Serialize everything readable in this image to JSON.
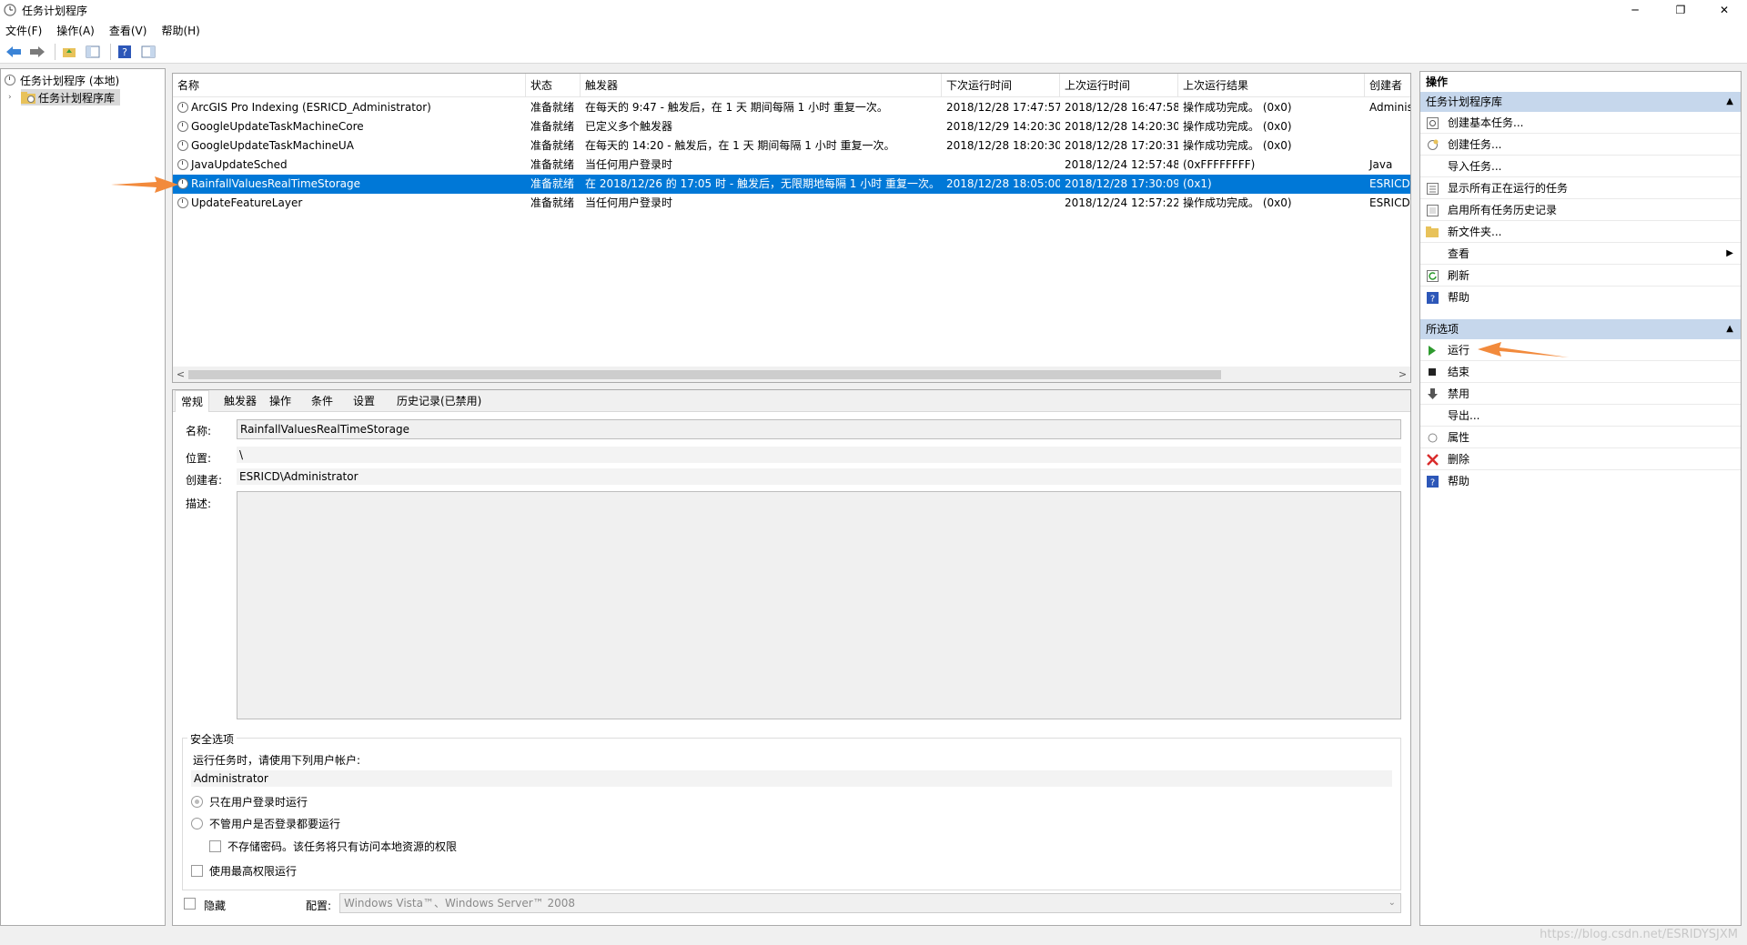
{
  "window": {
    "title": "任务计划程序",
    "controls": {
      "minimize": "─",
      "restore": "❐",
      "close": "✕"
    }
  },
  "menu": [
    "文件(F)",
    "操作(A)",
    "查看(V)",
    "帮助(H)"
  ],
  "tree": {
    "root": "任务计划程序 (本地)",
    "child": "任务计划程序库"
  },
  "list": {
    "columns": [
      "名称",
      "状态",
      "触发器",
      "下次运行时间",
      "上次运行时间",
      "上次运行结果",
      "创建者"
    ],
    "rows": [
      {
        "name": "ArcGIS Pro Indexing (ESRICD_Administrator)",
        "status": "准备就绪",
        "trigger": "在每天的 9:47 - 触发后，在 1 天 期间每隔 1 小时 重复一次。",
        "next": "2018/12/28 17:47:57",
        "last": "2018/12/28 16:47:58",
        "result": "操作成功完成。 (0x0)",
        "author": "Adminis"
      },
      {
        "name": "GoogleUpdateTaskMachineCore",
        "status": "准备就绪",
        "trigger": "已定义多个触发器",
        "next": "2018/12/29 14:20:30",
        "last": "2018/12/28 14:20:30",
        "result": "操作成功完成。 (0x0)",
        "author": ""
      },
      {
        "name": "GoogleUpdateTaskMachineUA",
        "status": "准备就绪",
        "trigger": "在每天的 14:20 - 触发后，在 1 天 期间每隔 1 小时 重复一次。",
        "next": "2018/12/28 18:20:30",
        "last": "2018/12/28 17:20:31",
        "result": "操作成功完成。 (0x0)",
        "author": ""
      },
      {
        "name": "JavaUpdateSched",
        "status": "准备就绪",
        "trigger": "当任何用户登录时",
        "next": "",
        "last": "2018/12/24 12:57:48",
        "result": "(0xFFFFFFFF)",
        "author": "Java"
      },
      {
        "name": "RainfallValuesRealTimeStorage",
        "status": "准备就绪",
        "trigger": "在 2018/12/26 的 17:05 时 - 触发后，无限期地每隔 1 小时 重复一次。",
        "next": "2018/12/28 18:05:00",
        "last": "2018/12/28 17:30:09",
        "result": "(0x1)",
        "author": "ESRICD\\"
      },
      {
        "name": "UpdateFeatureLayer",
        "status": "准备就绪",
        "trigger": "当任何用户登录时",
        "next": "",
        "last": "2018/12/24 12:57:22",
        "result": "操作成功完成。 (0x0)",
        "author": "ESRICD\\"
      }
    ],
    "selected_index": 4,
    "scroll_left": "<",
    "scroll_right": ">"
  },
  "details": {
    "tabs": [
      "常规",
      "触发器",
      "操作",
      "条件",
      "设置",
      "历史记录(已禁用)"
    ],
    "name_label": "名称:",
    "name_value": "RainfallValuesRealTimeStorage",
    "location_label": "位置:",
    "location_value": "\\",
    "author_label": "创建者:",
    "author_value": "ESRICD\\Administrator",
    "desc_label": "描述:",
    "security_title": "安全选项",
    "run_as_label": "运行任务时，请使用下列用户帐户:",
    "run_as_user": "Administrator",
    "opt_logged_on": "只在用户登录时运行",
    "opt_any": "不管用户是否登录都要运行",
    "opt_no_password": "不存储密码。该任务将只有访问本地资源的权限",
    "opt_highest": "使用最高权限运行",
    "hidden_label": "隐藏",
    "config_label": "配置:",
    "config_value": "Windows Vista™、Windows Server™ 2008"
  },
  "actions": {
    "header": "操作",
    "lib_section": "任务计划程序库",
    "lib_items": [
      "创建基本任务...",
      "创建任务...",
      "导入任务...",
      "显示所有正在运行的任务",
      "启用所有任务历史记录",
      "新文件夹...",
      "查看",
      "刷新",
      "帮助"
    ],
    "sel_section": "所选项",
    "sel_items": [
      "运行",
      "结束",
      "禁用",
      "导出...",
      "属性",
      "删除",
      "帮助"
    ]
  },
  "watermark": "https://blog.csdn.net/ESRIDYSJXM",
  "colors": {
    "selection": "#0078d7",
    "section_header": "#c6d7ec",
    "annotation_arrow": "#f28a3c"
  }
}
